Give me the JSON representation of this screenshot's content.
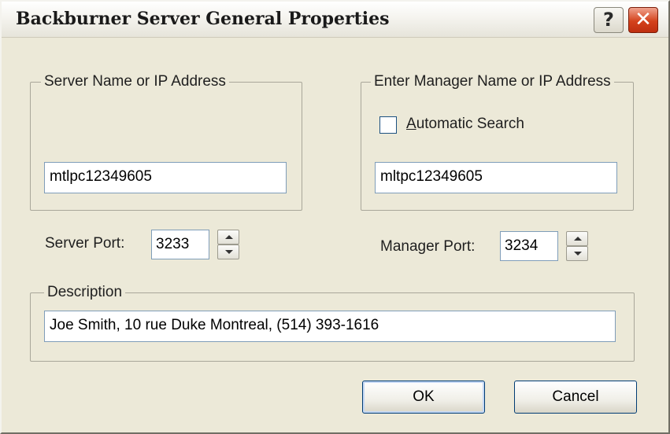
{
  "window": {
    "title": "Backburner Server General Properties",
    "help_glyph": "?",
    "close_glyph": "✕"
  },
  "server_group": {
    "legend": "Server Name or IP Address",
    "name_value": "mtlpc12349605"
  },
  "manager_group": {
    "legend": "Enter Manager Name or IP Address",
    "auto_search_access_key": "A",
    "auto_search_rest": "utomatic Search",
    "auto_search_checked": false,
    "name_value": "mltpc12349605"
  },
  "server_port": {
    "label": "Server Port:",
    "value": "3233"
  },
  "manager_port": {
    "label": "Manager Port:",
    "value": "3234"
  },
  "description": {
    "legend": "Description",
    "value": "Joe Smith, 10 rue Duke Montreal, (514) 393-1616"
  },
  "buttons": {
    "ok": "OK",
    "cancel": "Cancel"
  },
  "colors": {
    "dialog_bg": "#ece9d8",
    "input_border": "#7f9db9",
    "close_button": "#d4421c"
  }
}
